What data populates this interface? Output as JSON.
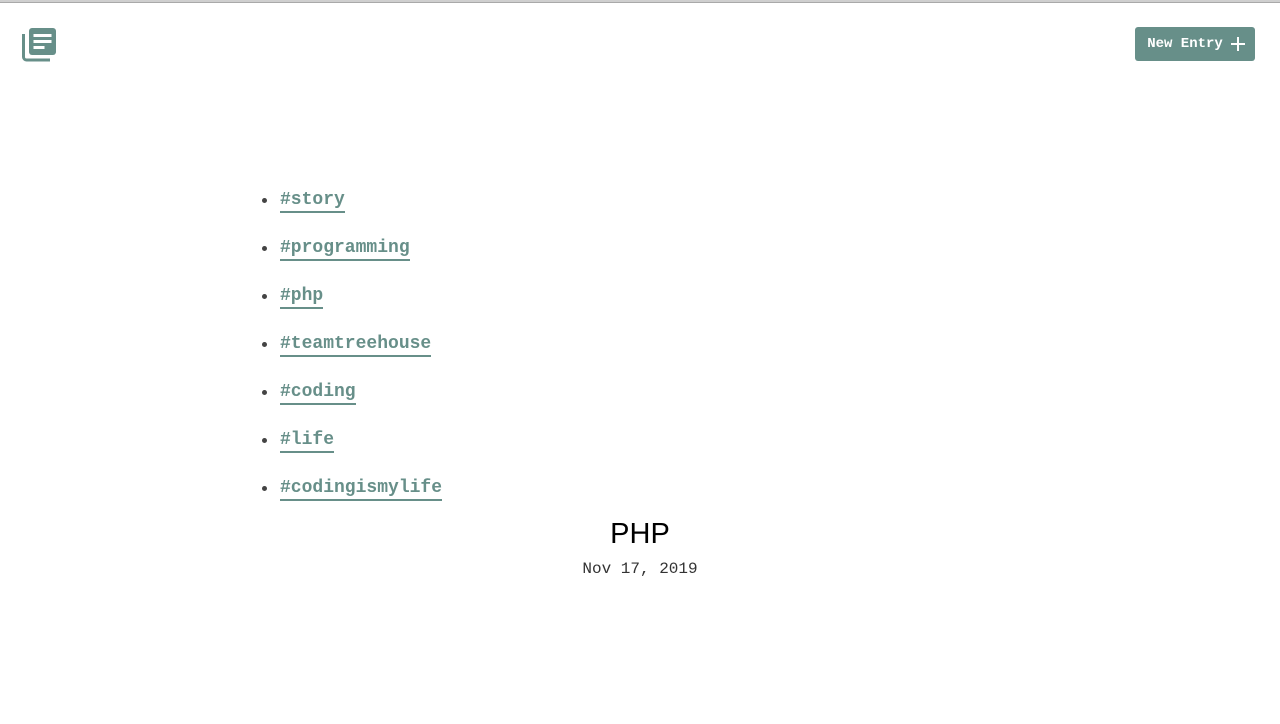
{
  "header": {
    "logo_icon": "journal-list-icon",
    "new_entry_label": "New Entry",
    "new_entry_icon": "plus-icon",
    "accent_color": "#678f89"
  },
  "tags": [
    {
      "label": "#story"
    },
    {
      "label": "#programming"
    },
    {
      "label": "#php"
    },
    {
      "label": "#teamtreehouse"
    },
    {
      "label": "#coding"
    },
    {
      "label": "#life"
    },
    {
      "label": "#codingismylife"
    }
  ],
  "entry": {
    "title": "PHP",
    "date": "Nov 17, 2019"
  }
}
